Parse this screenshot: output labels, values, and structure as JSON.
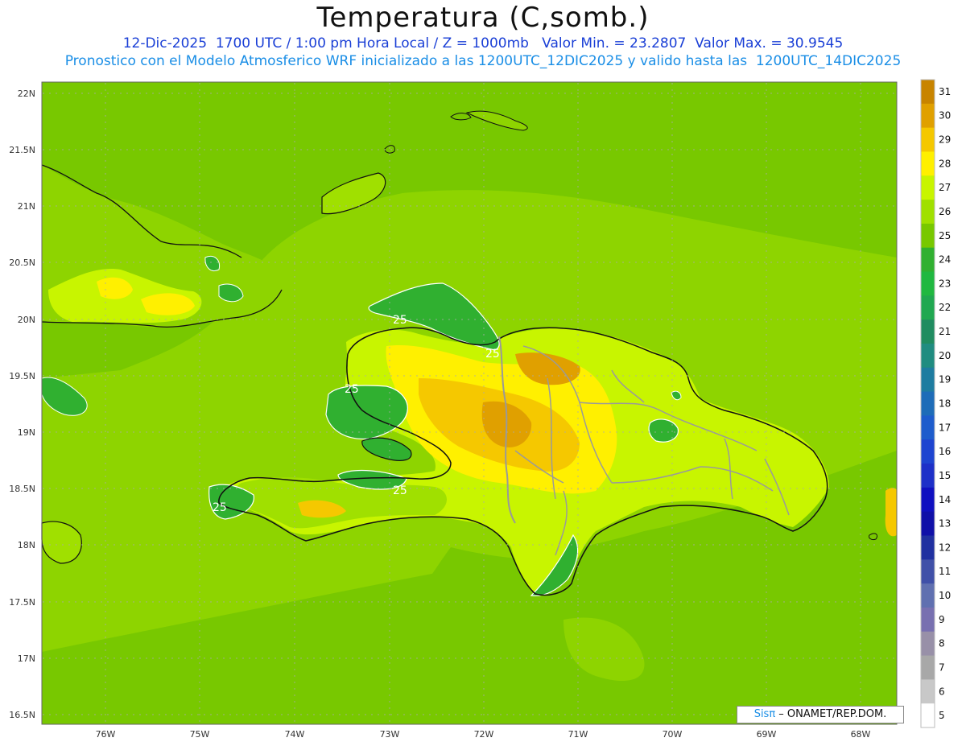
{
  "header": {
    "title": "Temperatura (C,somb.)",
    "line1": "12-Dic-2025  1700 UTC / 1:00 pm Hora Local / Z = 1000mb   Valor Min. = 23.2807  Valor Max. = 30.9545",
    "line2": "Pronostico con el Modelo Atmosferico WRF inicializado a las 1200UTC_12DIC2025 y valido hasta las  1200UTC_14DIC2025"
  },
  "map": {
    "lat_labels": [
      "22N",
      "21.5N",
      "21N",
      "20.5N",
      "20N",
      "19.5N",
      "19N",
      "18.5N",
      "18N",
      "17.5N",
      "17N",
      "16.5N"
    ],
    "lon_labels": [
      "76W",
      "75W",
      "74W",
      "73W",
      "72W",
      "71W",
      "70W",
      "69W",
      "68W"
    ],
    "contour_labels": [
      "25",
      "25",
      "25",
      "25",
      "25",
      "25"
    ]
  },
  "colorbar": {
    "labels": [
      "31",
      "30",
      "29",
      "28",
      "27",
      "26",
      "25",
      "24",
      "23",
      "22",
      "21",
      "20",
      "19",
      "18",
      "17",
      "16",
      "15",
      "14",
      "13",
      "12",
      "11",
      "10",
      "9",
      "8",
      "7",
      "6",
      "5"
    ],
    "colors": [
      "#c88400",
      "#e0a000",
      "#f5c800",
      "#fff000",
      "#c8f500",
      "#a0e000",
      "#78c800",
      "#30b030",
      "#20b840",
      "#20a850",
      "#208c60",
      "#208c80",
      "#1e7ca0",
      "#1e6cb8",
      "#1e5ccc",
      "#1e44d0",
      "#1e30c8",
      "#1010c0",
      "#1010a8",
      "#2030a0",
      "#4050a8",
      "#6070b0",
      "#7870b0",
      "#9890a8",
      "#a8a8a8",
      "#c8c8c8",
      "#ffffff"
    ]
  },
  "credit": {
    "sis": "Sisπ",
    "rest": " – ONAMET/REP.DOM."
  },
  "colors": {
    "sea": "#78c800",
    "island_warm": "#c8f500",
    "hot": "#f5c800",
    "hottest": "#e0a000",
    "cool": "#30b030"
  }
}
